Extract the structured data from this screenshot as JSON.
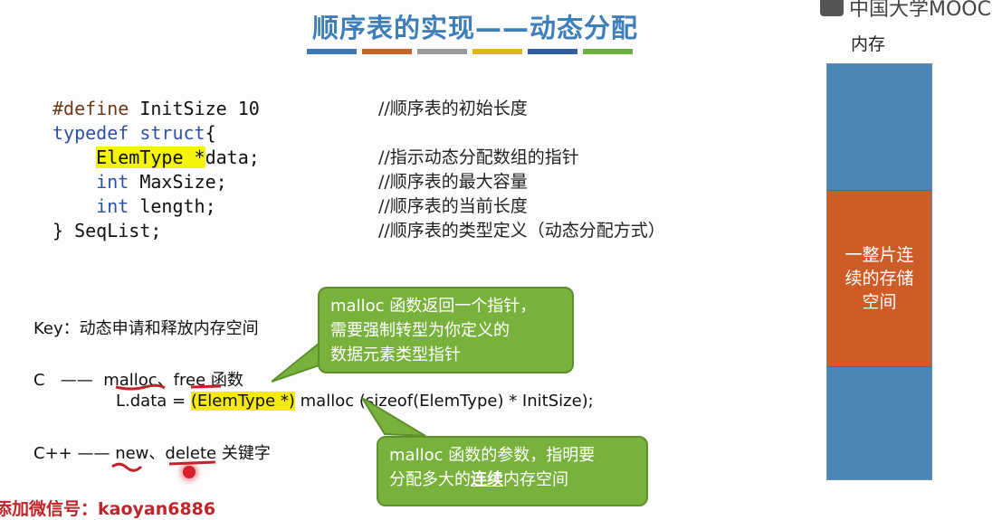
{
  "slide": {
    "title": "顺序表的实现——动态分配",
    "stripe_colors": [
      "#3a77b4",
      "#c96425",
      "#9a9a9a",
      "#e3b31e",
      "#2e5fa3",
      "#6ab03d"
    ],
    "logo_text": "中国大学MOOC"
  },
  "memory": {
    "label": "内存",
    "segment_text": [
      "一整片连",
      "续的存储",
      "空间"
    ],
    "colors": {
      "free": "#4a86b8",
      "allocated": "#cf5c26"
    }
  },
  "code": {
    "lines": [
      {
        "parts": [
          "#define",
          " InitSize 10"
        ],
        "comment": "//顺序表的初始长度"
      },
      {
        "parts": [
          "typedef struct",
          "{"
        ],
        "comment": ""
      },
      {
        "parts": [
          "    ",
          "ElemType *",
          "data;"
        ],
        "comment": "//指示动态分配数组的指针"
      },
      {
        "parts": [
          "    ",
          "int",
          " MaxSize;"
        ],
        "comment": "//顺序表的最大容量"
      },
      {
        "parts": [
          "    ",
          "int",
          " length;"
        ],
        "comment": "//顺序表的当前长度"
      },
      {
        "parts": [
          "} SeqList;"
        ],
        "comment": "//顺序表的类型定义（动态分配方式）"
      }
    ]
  },
  "key": {
    "label": "Key：动态申请和释放内存空间",
    "c_prefix": "C   ——  ",
    "c_malloc": "malloc",
    "c_sep": "、",
    "c_free": "free",
    "c_suffix": " 函数",
    "stmt_prefix": "L.data = ",
    "stmt_cast": "(ElemType *)",
    "stmt_rest": " malloc (sizeof(ElemType) * InitSize);",
    "cpp_prefix": "C++ —— ",
    "cpp_new": "new",
    "cpp_sep": "、",
    "cpp_delete": "delete",
    "cpp_suffix": " 关键字"
  },
  "bubbles": {
    "first": [
      "malloc 函数返回一个指针，",
      "需要强制转型为你定义的",
      "数据元素类型指针"
    ],
    "second_line1": "malloc 函数的参数，指明要",
    "second_pre": "分配多大的",
    "second_underlined": "连续",
    "second_post": "内存空间"
  },
  "footer_partial": "添加微信号：kaoyan6886"
}
